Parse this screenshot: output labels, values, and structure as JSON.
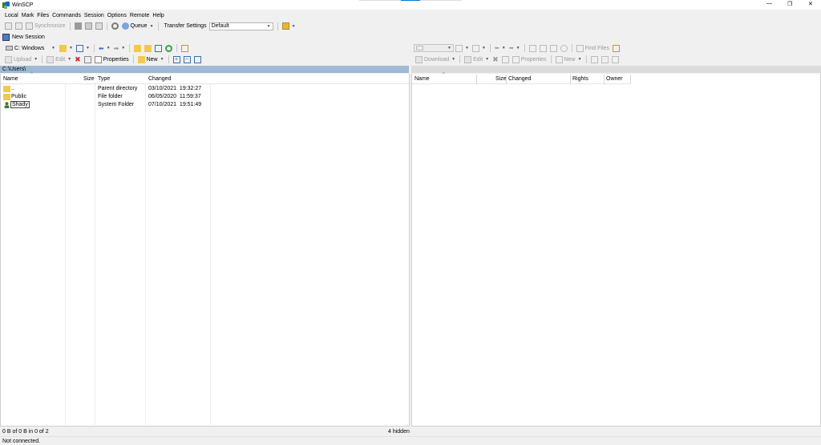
{
  "window": {
    "title": "WinSCP",
    "controls": {
      "minimize": "—",
      "maximize": "❐",
      "close": "✕"
    }
  },
  "menu": [
    "Local",
    "Mark",
    "Files",
    "Commands",
    "Session",
    "Options",
    "Remote",
    "Help"
  ],
  "toolbar1": {
    "synchronize": "Synchronize",
    "queue": "Queue",
    "transfer_settings_label": "Transfer Settings",
    "transfer_settings_value": "Default"
  },
  "session_tab": "New Session",
  "left": {
    "drive": "C: Windows",
    "actions": {
      "upload": "Upload",
      "edit": "Edit",
      "properties": "Properties",
      "new": "New"
    },
    "path": "C:\\Users\\",
    "columns": [
      "Name",
      "Size",
      "Type",
      "Changed"
    ],
    "files": [
      {
        "name": "..",
        "size": "",
        "type": "Parent directory",
        "changed": "03/10/2021  19:32:27",
        "icon": "parent-folder-icon"
      },
      {
        "name": "Public",
        "size": "",
        "type": "File folder",
        "changed": "06/05/2020  11:59:37",
        "icon": "folder-icon"
      },
      {
        "name": "Shady",
        "size": "",
        "type": "System Folder",
        "changed": "07/10/2021  19:51:49",
        "icon": "user-folder-icon"
      }
    ]
  },
  "right": {
    "actions": {
      "find_files": "Find Files",
      "download": "Download",
      "edit": "Edit",
      "properties": "Properties",
      "new": "New"
    },
    "columns": [
      "Name",
      "Size",
      "Changed",
      "Rights",
      "Owner"
    ]
  },
  "status": {
    "selection": "0 B of 0 B in 0 of 2",
    "hidden": "4 hidden",
    "connection": "Not connected."
  },
  "colors": {
    "path_bar_active": "#9fb9d6",
    "path_bar_inactive": "#dcdcdc",
    "accent": "#0078d7"
  }
}
